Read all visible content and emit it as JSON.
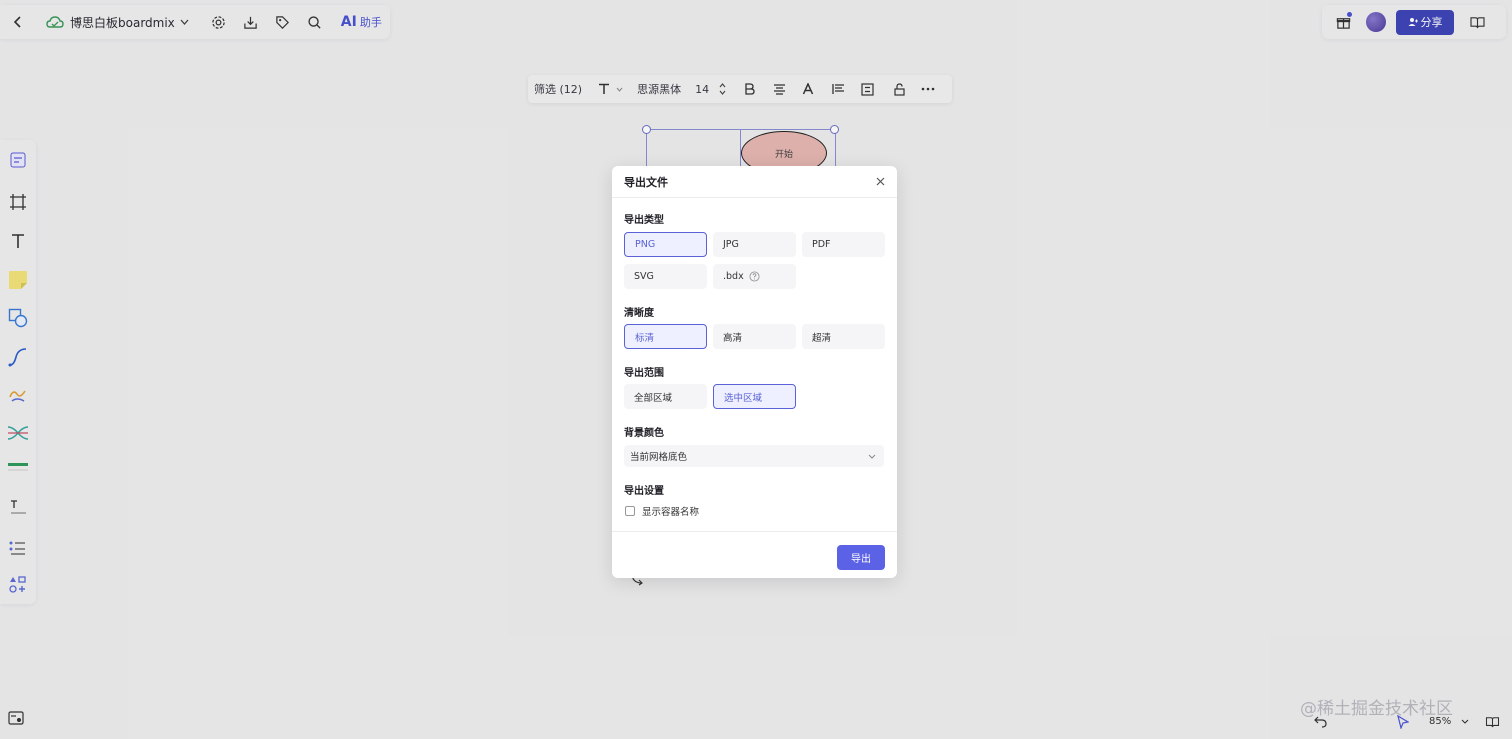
{
  "header": {
    "doc_title": "博思白板boardmix",
    "ai_label": "AI",
    "ai_sub": "助手",
    "share_label": "分享"
  },
  "format_bar": {
    "filter_label": "筛选 (12)",
    "font_name": "思源黑体",
    "font_size": "14"
  },
  "canvas": {
    "shape_text": "开始"
  },
  "modal": {
    "title": "导出文件",
    "export_type_label": "导出类型",
    "export_types": [
      "PNG",
      "JPG",
      "PDF",
      "SVG",
      ".bdx"
    ],
    "selected_type": "PNG",
    "clarity_label": "清晰度",
    "clarity_options": [
      "标清",
      "高清",
      "超清"
    ],
    "selected_clarity": "标清",
    "range_label": "导出范围",
    "range_options": [
      "全部区域",
      "选中区域"
    ],
    "selected_range": "选中区域",
    "bg_label": "背景颜色",
    "bg_value": "当前网格底色",
    "settings_label": "导出设置",
    "show_container_name": "显示容器名称",
    "export_button": "导出"
  },
  "bottom": {
    "zoom": "85%",
    "watermark": "@稀土掘金技术社区"
  },
  "colors": {
    "accent": "#5b62e6",
    "share_bg": "#3f46b8",
    "shape_fill": "#e7b8b2"
  }
}
